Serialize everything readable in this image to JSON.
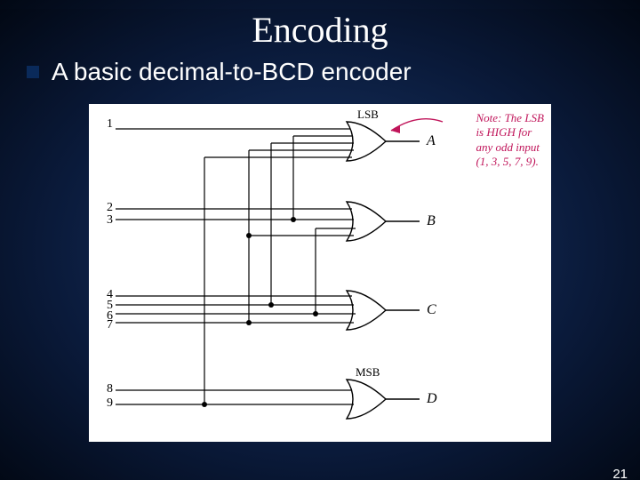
{
  "slide": {
    "title": "Encoding",
    "bullet": "A basic decimal-to-BCD encoder",
    "page_number": "21"
  },
  "diagram": {
    "inputs": [
      "1",
      "2",
      "3",
      "4",
      "5",
      "6",
      "7",
      "8",
      "9"
    ],
    "gates": [
      {
        "label_bit": "LSB",
        "label_out": "A"
      },
      {
        "label_bit": "",
        "label_out": "B"
      },
      {
        "label_bit": "",
        "label_out": "C"
      },
      {
        "label_bit": "MSB",
        "label_out": "D"
      }
    ],
    "note_lines": [
      "Note:",
      "The LSB",
      "is HIGH for",
      "any odd input",
      "(1, 3, 5, 7, 9)."
    ]
  },
  "chart_data": {
    "type": "table",
    "title": "Decimal-to-BCD OR-gate encoder wiring",
    "inputs": [
      1,
      2,
      3,
      4,
      5,
      6,
      7,
      8,
      9
    ],
    "outputs": [
      "A (LSB)",
      "B",
      "C",
      "D (MSB)"
    ],
    "connections": {
      "A": [
        1,
        3,
        5,
        7,
        9
      ],
      "B": [
        2,
        3,
        6,
        7
      ],
      "C": [
        4,
        5,
        6,
        7
      ],
      "D": [
        8,
        9
      ]
    }
  }
}
